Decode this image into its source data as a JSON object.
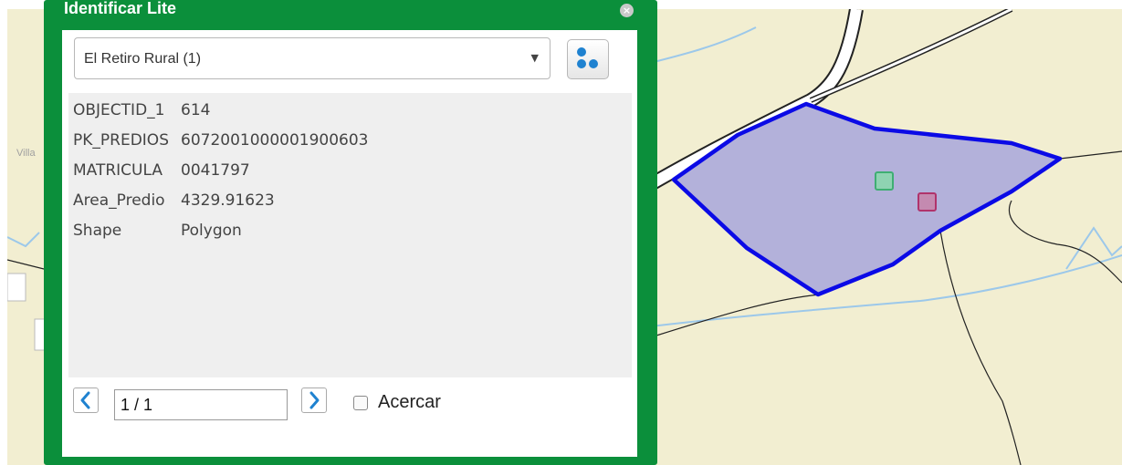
{
  "widget": {
    "title": "Identificar Lite",
    "close_symbol": "×",
    "layer_select": {
      "selected": "El Retiro Rural (1)",
      "arrow_symbol": "▼"
    },
    "switch_icon": "dots-cluster-icon",
    "attributes": [
      {
        "key": "OBJECTID_1",
        "value": "614"
      },
      {
        "key": "PK_PREDIOS",
        "value": "6072001000001900603"
      },
      {
        "key": "MATRICULA",
        "value": "0041797"
      },
      {
        "key": "Area_Predio",
        "value": "4329.91623"
      },
      {
        "key": "Shape",
        "value": "Polygon"
      }
    ],
    "pager": {
      "value": "1 / 1",
      "zoom_label": "Acercar"
    }
  },
  "map": {
    "partial_label": "Villa",
    "colors": {
      "background": "#f2eed1",
      "parcel_fill": "#b3b1da",
      "parcel_stroke": "#0b0ae6",
      "widget_green": "#0b8f3b",
      "stream": "#9cc8ea"
    }
  }
}
